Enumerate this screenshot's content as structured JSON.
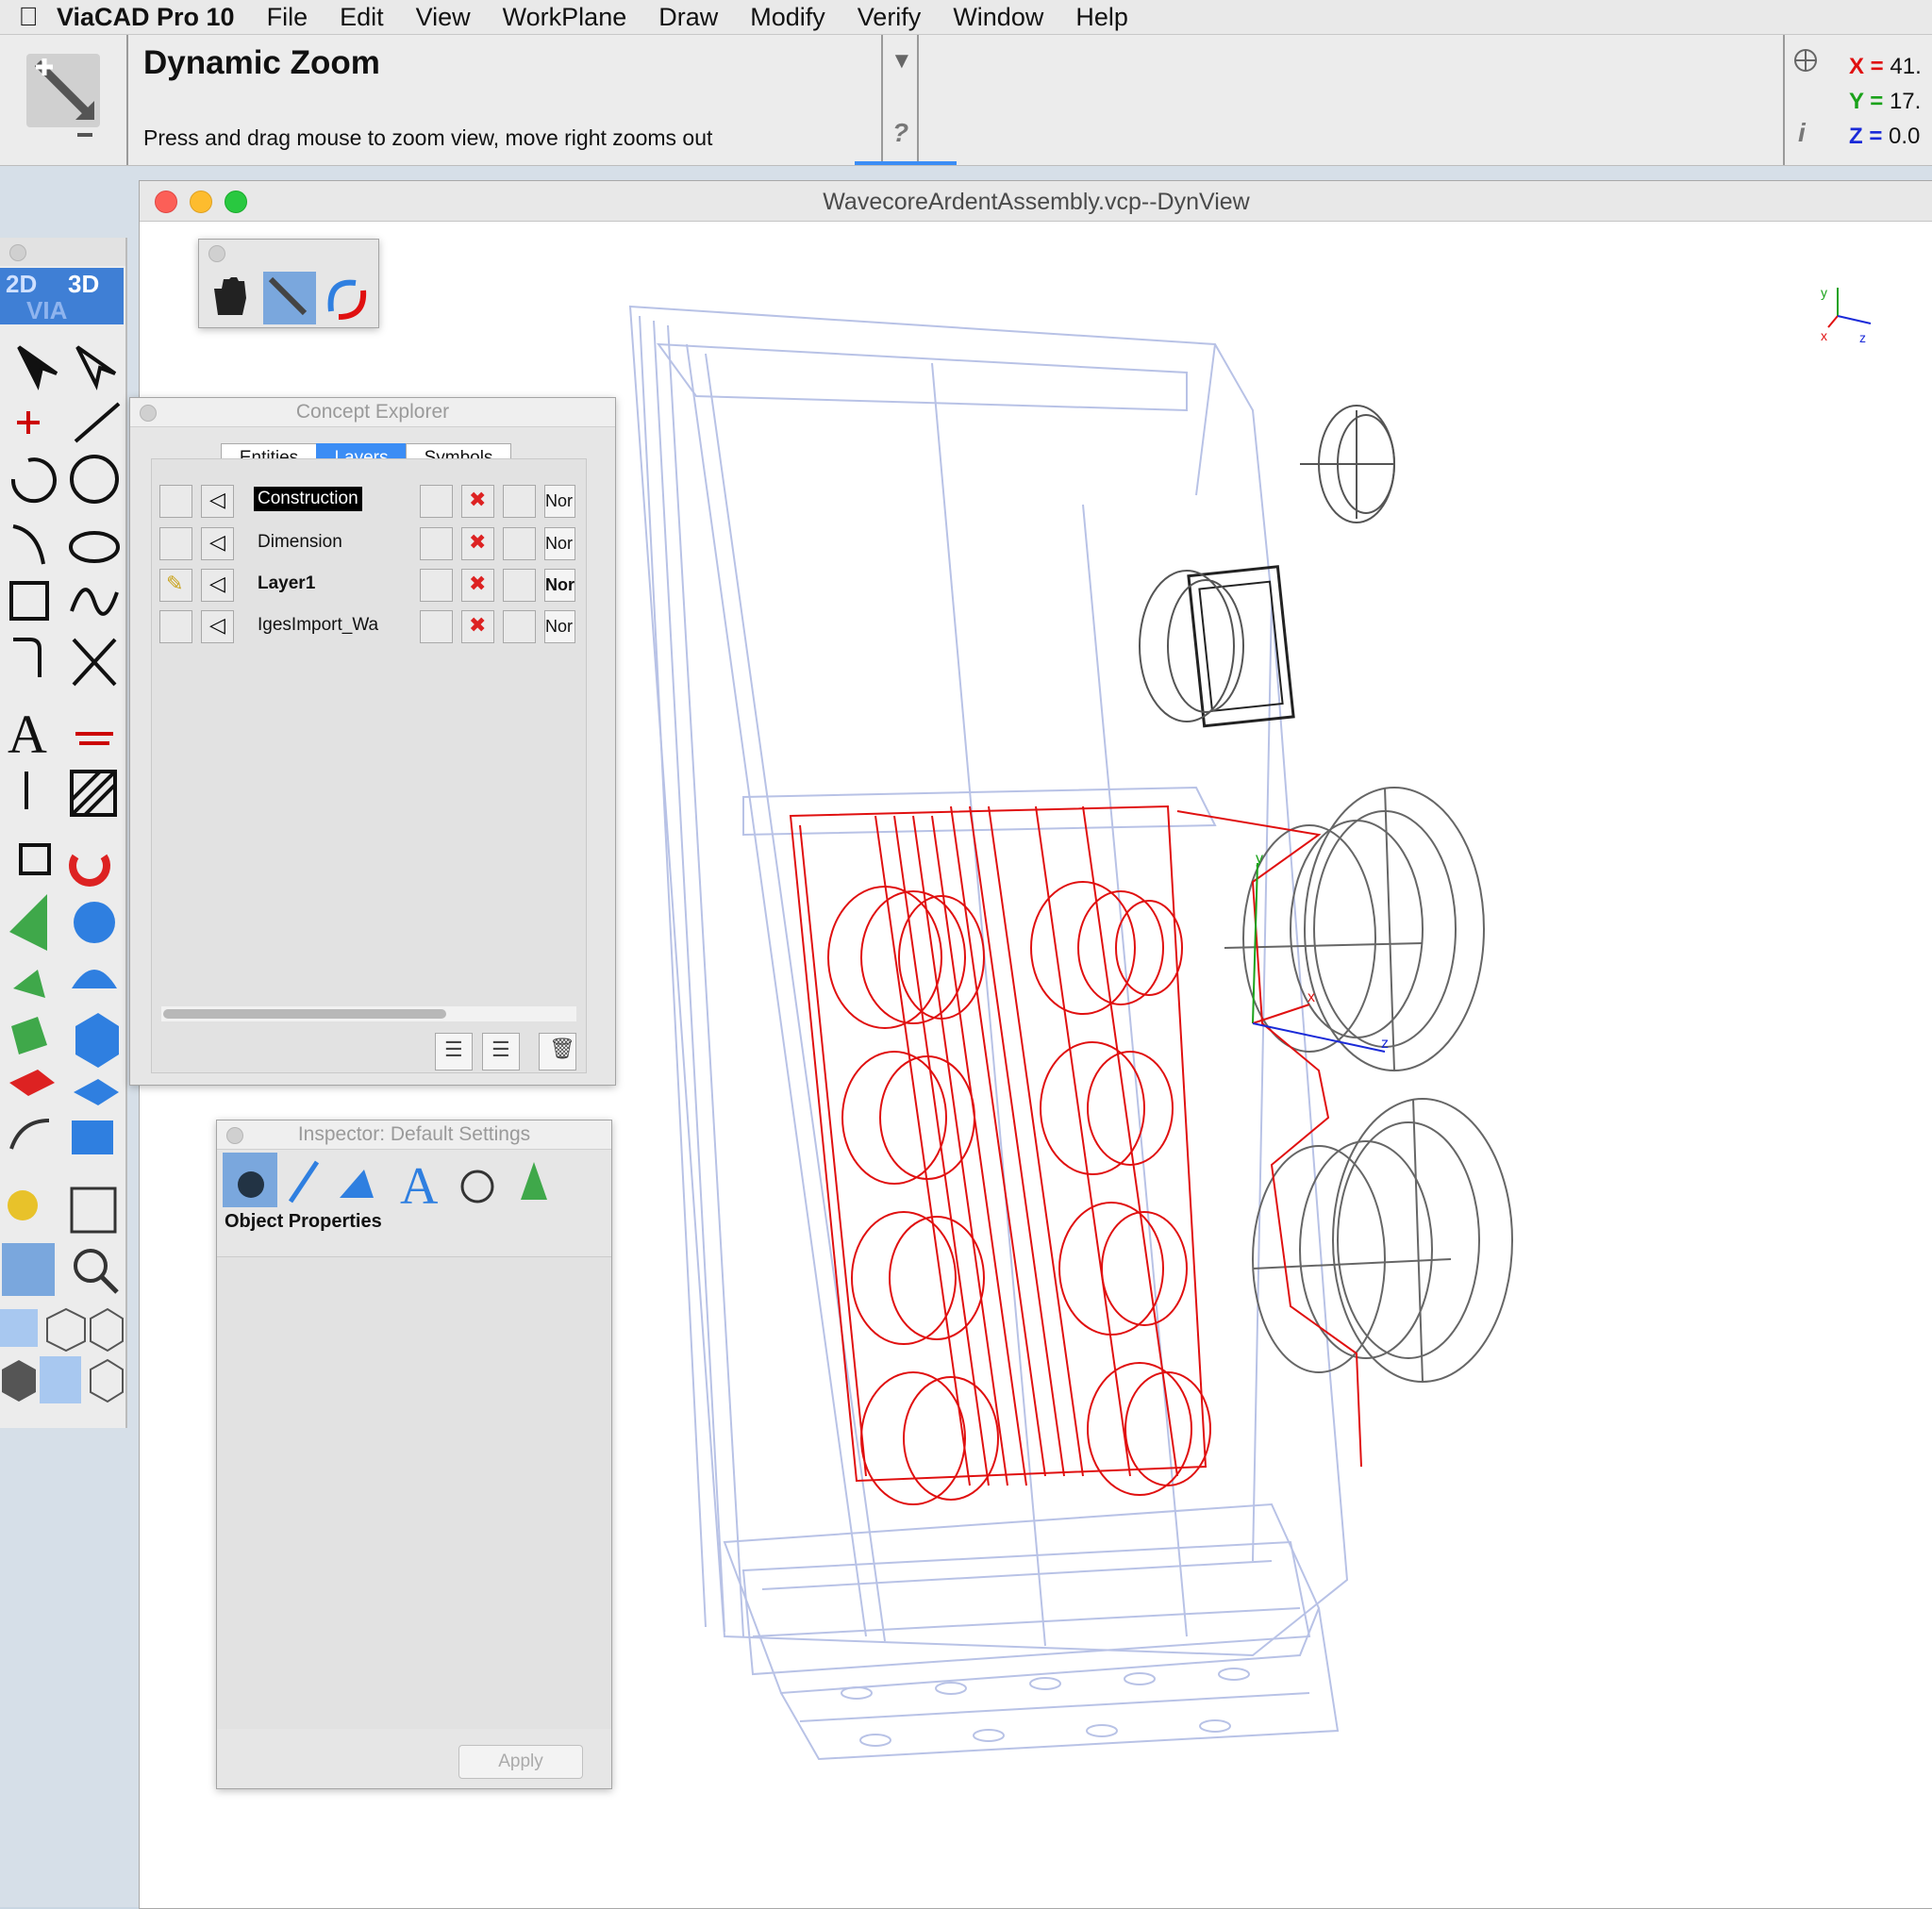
{
  "menubar": {
    "app_name": "ViaCAD Pro 10",
    "items": [
      "File",
      "Edit",
      "View",
      "WorkPlane",
      "Draw",
      "Modify",
      "Verify",
      "Window",
      "Help"
    ]
  },
  "status": {
    "tool_title": "Dynamic Zoom",
    "tool_hint": "Press and drag mouse to zoom view, move right zooms out",
    "help_glyph": "?",
    "info_glyph": "i",
    "coords": [
      {
        "label": "X =",
        "value": "41.",
        "color": "#e01010"
      },
      {
        "label": "Y =",
        "value": "17.",
        "color": "#1aa21a"
      },
      {
        "label": "Z =",
        "value": "0.0",
        "color": "#1a2ad8"
      }
    ]
  },
  "document": {
    "title": "WavecoreArdentAssembly.vcp--DynView"
  },
  "toolbox": {
    "header_2d": "2D",
    "header_3d": "3D",
    "header_via": "VIA",
    "text_tool_glyph": "A"
  },
  "explorer": {
    "title": "Concept Explorer",
    "tabs": [
      "Entities",
      "Layers",
      "Symbols"
    ],
    "selected_tab": "Layers",
    "layers": [
      {
        "name": "Construction",
        "render": "Nor",
        "selected": true,
        "bold": false
      },
      {
        "name": "Dimension",
        "render": "Nor",
        "selected": false,
        "bold": false
      },
      {
        "name": "Layer1",
        "render": "Nor",
        "selected": false,
        "bold": true
      },
      {
        "name": "IgesImport_Wa",
        "render": "Nor",
        "selected": false,
        "bold": false
      }
    ]
  },
  "inspector": {
    "title": "Inspector: Default Settings",
    "section": "Object Properties",
    "apply_label": "Apply"
  },
  "axis_labels": {
    "x": "x",
    "y": "y",
    "z": "z"
  },
  "colors": {
    "selected_tab": "#3b8df5",
    "wire_red": "#e01010",
    "wire_light": "#b8c2e6",
    "wire_dark": "#333333"
  }
}
